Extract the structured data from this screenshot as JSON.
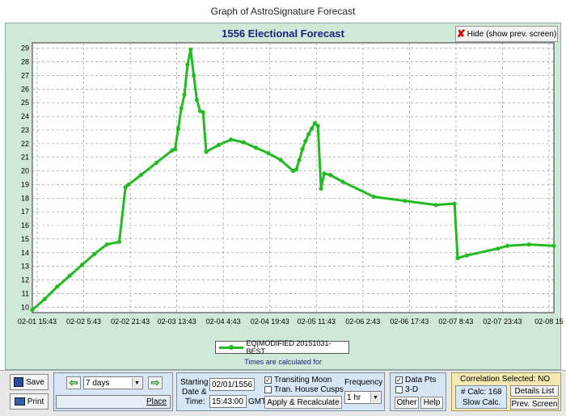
{
  "window_title": "Graph of AstroSignature Forecast",
  "hide_button": "Hide (show prev. screen)",
  "chart_data": {
    "type": "line",
    "title": "1556 Electional Forecast",
    "ylim": [
      9.6,
      29.4
    ],
    "yticks": [
      10,
      11,
      12,
      13,
      14,
      15,
      16,
      17,
      18,
      19,
      20,
      21,
      22,
      23,
      24,
      25,
      26,
      27,
      28,
      29
    ],
    "xlim": [
      0,
      168
    ],
    "xtick_labels": [
      "02-01 15:43",
      "02-02 5:43",
      "02-02 21:43",
      "02-03 13:43",
      "02-04 4:43",
      "02-04 19:43",
      "02-05 11:43",
      "02-06 2:43",
      "02-06 17:43",
      "02-07 8:43",
      "02-07 23:43",
      "02-08 15"
    ],
    "grid": true,
    "legend_position": "bottom-center",
    "series": [
      {
        "name": "EQ|MODIFIED 20151031-BEST",
        "color": "#22bb22",
        "x": [
          0,
          4,
          8,
          12,
          16,
          20,
          24,
          28,
          30,
          31,
          35,
          40,
          45,
          46,
          47,
          48,
          49,
          50,
          51,
          52,
          53,
          54,
          55,
          56,
          60,
          64,
          68,
          72,
          76,
          80,
          84,
          85,
          86,
          87,
          88,
          89,
          90,
          91,
          92,
          93,
          94,
          96,
          100,
          110,
          120,
          130,
          136,
          137,
          140,
          150,
          153,
          160,
          168
        ],
        "y": [
          9.8,
          10.6,
          11.5,
          12.3,
          13.1,
          13.9,
          14.6,
          14.8,
          18.8,
          19,
          19.7,
          20.6,
          21.5,
          21.6,
          23.1,
          24.6,
          25.6,
          27.8,
          28.9,
          27.0,
          25.2,
          24.4,
          24.3,
          21.4,
          21.9,
          22.3,
          22.1,
          21.7,
          21.3,
          20.8,
          20.0,
          20.1,
          20.8,
          21.6,
          22.2,
          22.7,
          23.1,
          23.5,
          23.3,
          18.7,
          19.8,
          19.7,
          19.2,
          18.1,
          17.8,
          17.5,
          17.6,
          13.6,
          13.8,
          14.3,
          14.5,
          14.6,
          14.5
        ]
      }
    ]
  },
  "times_note": "Times are calculated for",
  "toolbar": {
    "save": "Save",
    "print": "Print",
    "range_value": "7 days",
    "place": "Place",
    "starting_label": "Starting",
    "date_label": "Date &",
    "time_label": "Time:",
    "date_value": "02/01/1556",
    "time_value": "15:43:00",
    "gmt": "GMT",
    "transiting_moon": "Transiting Moon",
    "tran_house_cusps": "Tran. House Cusps",
    "apply": "Apply & Recalculate",
    "frequency_label": "Frequency",
    "frequency_value": "1 hr",
    "data_pts": "Data Pts",
    "three_d": "3-D",
    "other": "Other",
    "help": "Help",
    "correlation": "Correlation Selected: NO",
    "calc_count": "# Calc: 168",
    "slow_calc": "Slow Calc.",
    "details_list": "Details List",
    "prev_screen": "Prev. Screen"
  }
}
